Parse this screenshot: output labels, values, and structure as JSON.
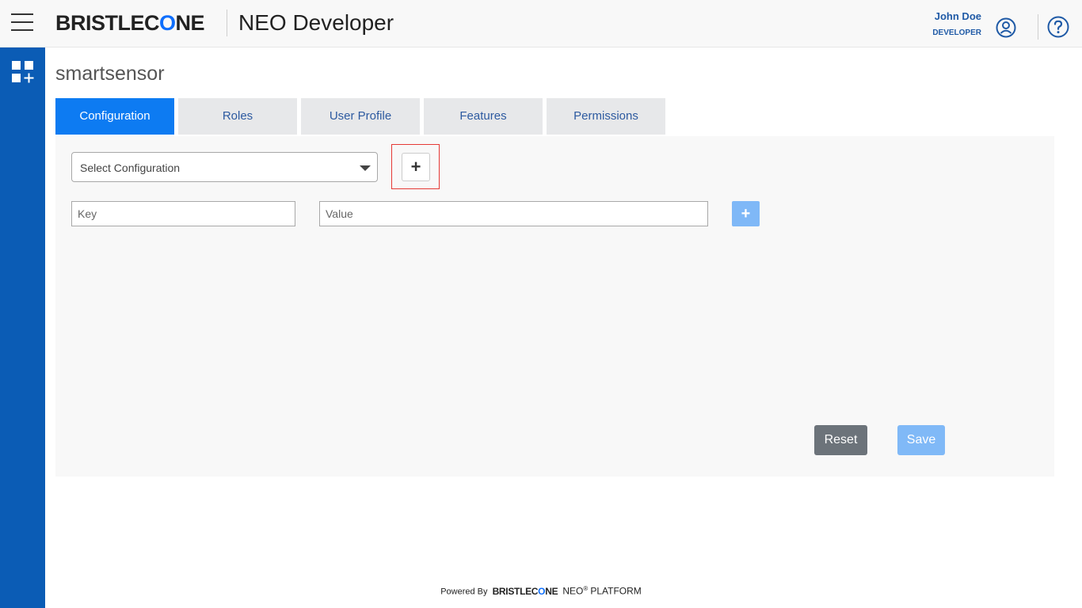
{
  "header": {
    "brand_prefix": "BRISTLEC",
    "brand_o": "O",
    "brand_suffix": "NE",
    "app_title": "NEO Developer",
    "user_name": "John Doe",
    "user_role": "DEVELOPER"
  },
  "page": {
    "title": "smartsensor"
  },
  "tabs": [
    {
      "label": "Configuration",
      "active": true
    },
    {
      "label": "Roles",
      "active": false
    },
    {
      "label": "User Profile",
      "active": false
    },
    {
      "label": "Features",
      "active": false
    },
    {
      "label": "Permissions",
      "active": false
    }
  ],
  "config": {
    "select_placeholder": "Select Configuration",
    "add_glyph": "+",
    "key_placeholder": "Key",
    "value_placeholder": "Value",
    "add_pair_glyph": "+"
  },
  "actions": {
    "reset_label": "Reset",
    "save_label": "Save"
  },
  "footer": {
    "powered_by": "Powered By",
    "brand_prefix": "BRISTLEC",
    "brand_o": "O",
    "brand_suffix": "NE",
    "neo": "NEO",
    "registered": "®",
    "platform": "PLATFORM"
  },
  "colors": {
    "sidebar": "#0b5cb5",
    "tab_active": "#0d7bf2",
    "tab_text": "#2d5aa0",
    "reset": "#6c737a",
    "save_disabled": "#80b9f7",
    "highlight": "#e53935"
  },
  "icons": [
    "hamburger-menu-icon",
    "user-avatar-icon",
    "help-icon",
    "apps-add-icon",
    "plus-icon",
    "caret-down-icon"
  ]
}
